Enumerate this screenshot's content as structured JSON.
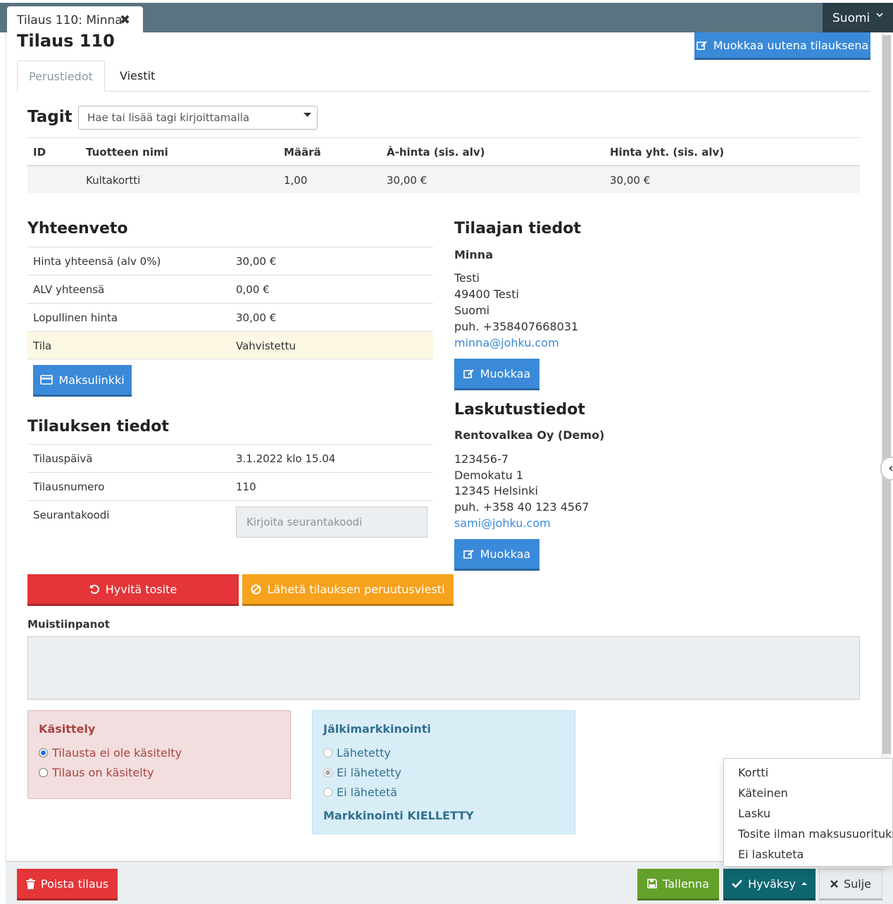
{
  "window": {
    "tab_label": "Tilaus 110: Minna",
    "tab_close": "✖",
    "language": "Suomi"
  },
  "header": {
    "title": "Tilaus 110",
    "edit_as_new_label": "Muokkaa uutena tilauksena"
  },
  "tabs": [
    {
      "label": "Perustiedot",
      "active": true
    },
    {
      "label": "Viestit",
      "active": false
    }
  ],
  "tags": {
    "label": "Tagit",
    "placeholder": "Hae tai lisää tagi kirjoittamalla"
  },
  "products": {
    "columns": [
      "ID",
      "Tuotteen nimi",
      "Määrä",
      "À-hinta (sis. alv)",
      "Hinta yht. (sis. alv)"
    ],
    "rows": [
      {
        "id": "",
        "name": "Kultakortti",
        "quantity": "1,00",
        "unit_price": "30,00 €",
        "total": "30,00 €"
      }
    ]
  },
  "summary": {
    "title": "Yhteenveto",
    "rows": [
      {
        "label": "Hinta yhteensä (alv 0%)",
        "value": "30,00 €"
      },
      {
        "label": "ALV yhteensä",
        "value": "0,00 €"
      },
      {
        "label": "Lopullinen hinta",
        "value": "30,00 €"
      },
      {
        "label": "Tila",
        "value": "Vahvistettu"
      }
    ],
    "payment_link_label": "Maksulinkki"
  },
  "order_info": {
    "title": "Tilauksen tiedot",
    "rows": [
      {
        "label": "Tilauspäivä",
        "value": "3.1.2022 klo 15.04"
      },
      {
        "label": "Tilausnumero",
        "value": "110"
      },
      {
        "label": "Seurantakoodi",
        "value": ""
      }
    ],
    "tracking_placeholder": "Kirjoita seurantakoodi"
  },
  "customer": {
    "title": "Tilaajan tiedot",
    "name": "Minna",
    "lines": [
      "Testi",
      "49400 Testi",
      "Suomi",
      "puh. +358407668031"
    ],
    "email": "minna@johku.com",
    "edit_label": "Muokkaa"
  },
  "billing": {
    "title": "Laskutustiedot",
    "name": "Rentovalkea Oy (Demo)",
    "lines": [
      "123456-7",
      "Demokatu 1",
      "12345 Helsinki",
      "puh. +358 40 123 4567"
    ],
    "email": "sami@johku.com",
    "edit_label": "Muokkaa"
  },
  "actions": {
    "refund_label": "Hyvitä tosite",
    "cancel_msg_label": "Lähetä tilauksen peruutusviesti"
  },
  "notes": {
    "label": "Muistiinpanot",
    "value": ""
  },
  "processing": {
    "title": "Käsittely",
    "options": [
      {
        "label": "Tilausta ei ole käsitelty",
        "checked": true
      },
      {
        "label": "Tilaus on käsitelty",
        "checked": false
      }
    ]
  },
  "remarketing": {
    "title": "Jälkimarkkinointi",
    "options": [
      {
        "label": "Lähetetty",
        "checked": false
      },
      {
        "label": "Ei lähetetty",
        "checked": true
      },
      {
        "label": "Ei lähetetä",
        "checked": false
      }
    ],
    "status": "Markkinointi KIELLETTY"
  },
  "approve_menu": {
    "items": [
      "Kortti",
      "Käteinen",
      "Lasku",
      "Tosite ilman maksusuorituksia",
      "Ei laskuteta"
    ]
  },
  "footer": {
    "delete_label": "Poista tilaus",
    "save_label": "Tallenna",
    "approve_label": "Hyväksy",
    "close_label": "Sulje"
  },
  "colors": {
    "primary": "#3a8ad9",
    "danger": "#e43538",
    "warning": "#f7a21d",
    "success": "#63a12b",
    "teal": "#0d6670",
    "topbar": "#5a7380"
  }
}
